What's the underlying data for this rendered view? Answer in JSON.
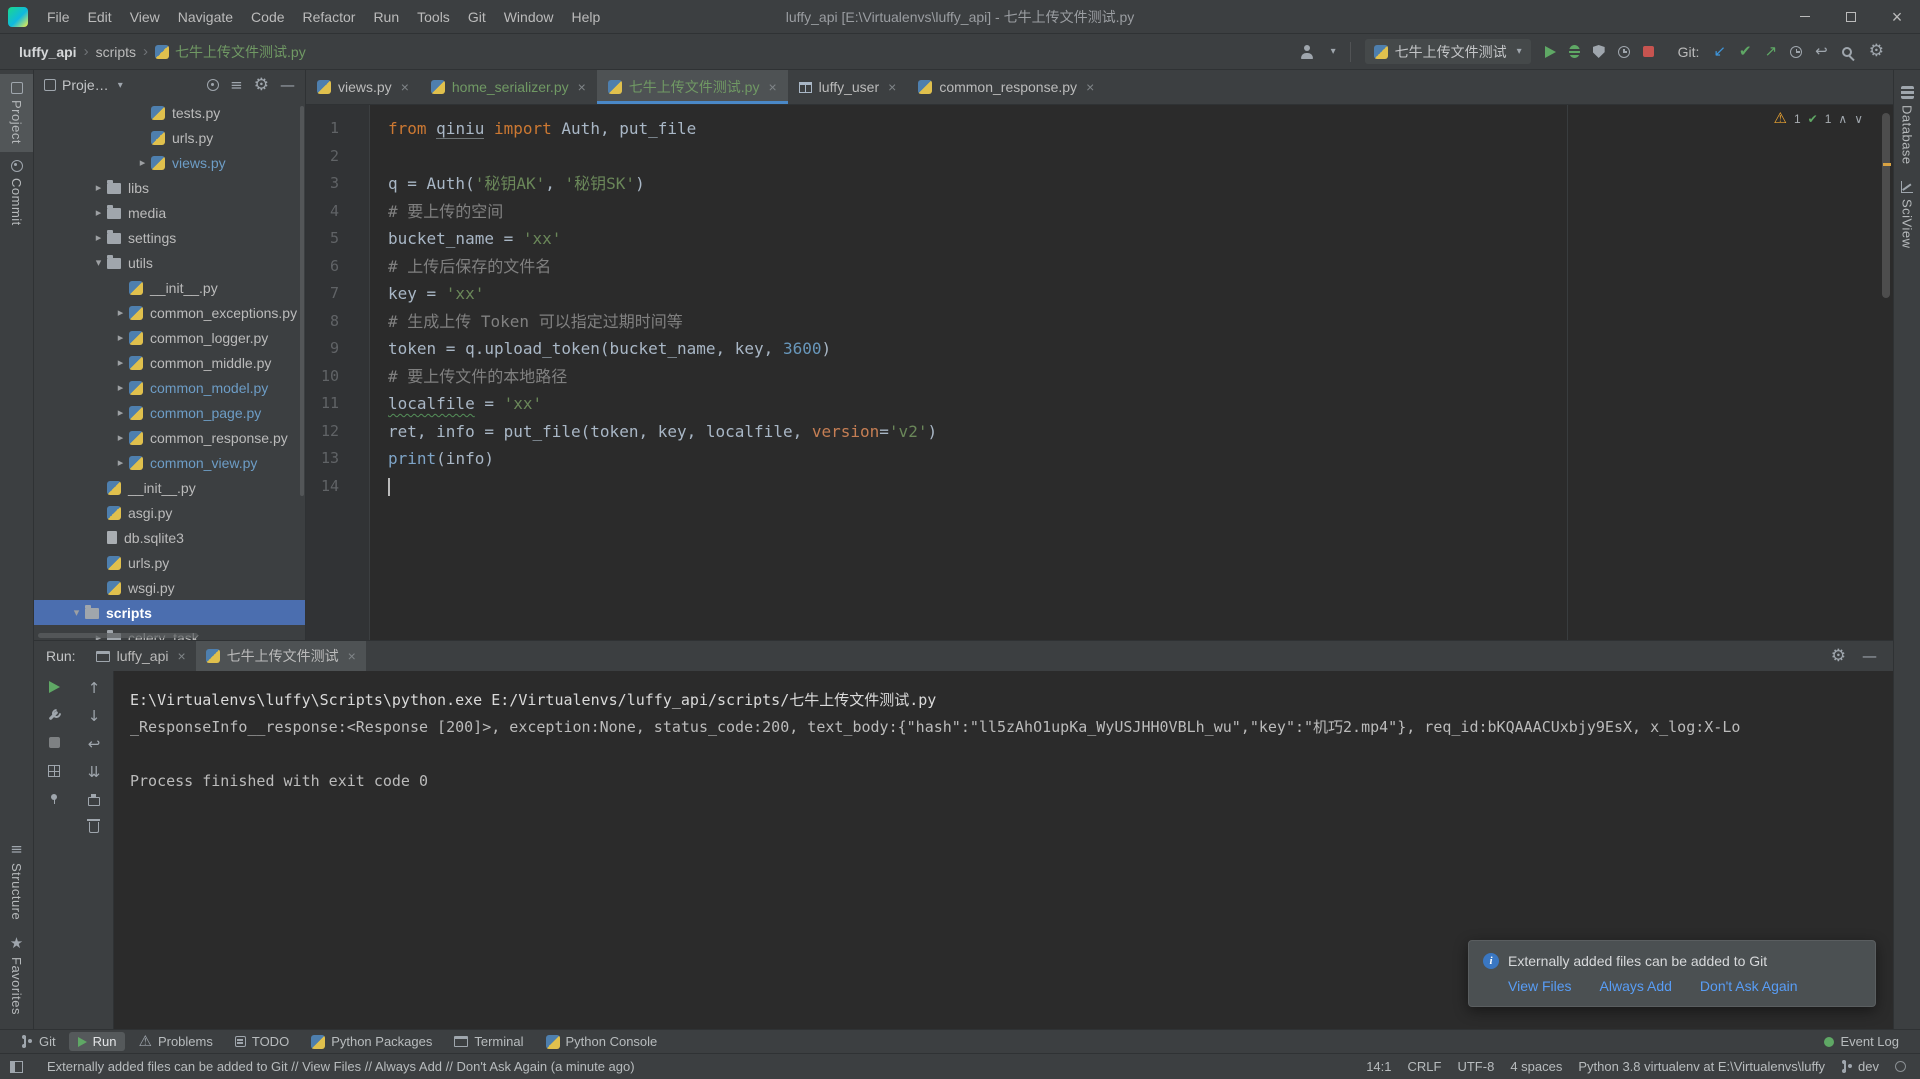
{
  "titlebar": {
    "title": "luffy_api [E:\\Virtualenvs\\luffy_api] - 七牛上传文件测试.py",
    "menus": [
      "File",
      "Edit",
      "View",
      "Navigate",
      "Code",
      "Refactor",
      "Run",
      "Tools",
      "Git",
      "Window",
      "Help"
    ]
  },
  "navbar": {
    "breadcrumbs": [
      "luffy_api",
      "scripts",
      "七牛上传文件测试.py"
    ],
    "run_config": "七牛上传文件测试",
    "git_label": "Git:",
    "action_icons": [
      "run-icon",
      "debug-icon",
      "coverage-icon",
      "profiler-icon",
      "stop-icon"
    ],
    "git_icons": [
      "git-update-icon",
      "git-commit-icon",
      "git-push-icon",
      "git-history-icon",
      "git-rollback-icon"
    ],
    "far_icons": [
      "search-icon",
      "settings-icon"
    ]
  },
  "left_stripe": {
    "top": [
      {
        "label": "Project",
        "icon": "project-icon",
        "active": true
      },
      {
        "label": "Commit",
        "icon": "commit-icon",
        "active": false
      }
    ],
    "bottom": [
      {
        "label": "Structure",
        "icon": "structure-icon",
        "active": false
      },
      {
        "label": "Favorites",
        "icon": "favorites-icon",
        "active": false
      }
    ]
  },
  "right_stripe": {
    "top": [
      {
        "label": "Database",
        "icon": "database-icon",
        "active": false
      },
      {
        "label": "SciView",
        "icon": "sciview-icon",
        "active": false
      }
    ]
  },
  "project_panel": {
    "title": "Proje…",
    "header_icons": [
      "locate-icon",
      "collapse-all-icon",
      "settings-icon",
      "hide-icon"
    ],
    "tree": [
      {
        "label": "tests.py",
        "depth": 4,
        "icon": "py",
        "chev": ""
      },
      {
        "label": "urls.py",
        "depth": 4,
        "icon": "py",
        "chev": ""
      },
      {
        "label": "views.py",
        "depth": 4,
        "icon": "py",
        "chev": ">",
        "color": "modified"
      },
      {
        "label": "libs",
        "depth": 2,
        "icon": "folder",
        "chev": ">"
      },
      {
        "label": "media",
        "depth": 2,
        "icon": "folder",
        "chev": ">"
      },
      {
        "label": "settings",
        "depth": 2,
        "icon": "folder",
        "chev": ">"
      },
      {
        "label": "utils",
        "depth": 2,
        "icon": "folder",
        "chev": "v"
      },
      {
        "label": "__init__.py",
        "depth": 3,
        "icon": "py",
        "chev": ""
      },
      {
        "label": "common_exceptions.py",
        "depth": 3,
        "icon": "py",
        "chev": ">"
      },
      {
        "label": "common_logger.py",
        "depth": 3,
        "icon": "py",
        "chev": ">"
      },
      {
        "label": "common_middle.py",
        "depth": 3,
        "icon": "py",
        "chev": ">"
      },
      {
        "label": "common_model.py",
        "depth": 3,
        "icon": "py",
        "chev": ">",
        "color": "modified"
      },
      {
        "label": "common_page.py",
        "depth": 3,
        "icon": "py",
        "chev": ">",
        "color": "modified"
      },
      {
        "label": "common_response.py",
        "depth": 3,
        "icon": "py",
        "chev": ">"
      },
      {
        "label": "common_view.py",
        "depth": 3,
        "icon": "py",
        "chev": ">",
        "color": "modified"
      },
      {
        "label": "__init__.py",
        "depth": 2,
        "icon": "py",
        "chev": ""
      },
      {
        "label": "asgi.py",
        "depth": 2,
        "icon": "py",
        "chev": ""
      },
      {
        "label": "db.sqlite3",
        "depth": 2,
        "icon": "file",
        "chev": ""
      },
      {
        "label": "urls.py",
        "depth": 2,
        "icon": "py",
        "chev": ""
      },
      {
        "label": "wsgi.py",
        "depth": 2,
        "icon": "py",
        "chev": ""
      },
      {
        "label": "scripts",
        "depth": 1,
        "icon": "folder",
        "chev": "v",
        "selected": true
      },
      {
        "label": "celery_task",
        "depth": 2,
        "icon": "folder",
        "chev": ">"
      }
    ]
  },
  "editor": {
    "tabs": [
      {
        "label": "views.py",
        "icon": "py",
        "active": false,
        "color": "default"
      },
      {
        "label": "home_serializer.py",
        "icon": "py",
        "active": false,
        "color": "new"
      },
      {
        "label": "七牛上传文件测试.py",
        "icon": "py",
        "active": true,
        "color": "new"
      },
      {
        "label": "luffy_user",
        "icon": "table",
        "active": false,
        "color": "default"
      },
      {
        "label": "common_response.py",
        "icon": "py",
        "active": false,
        "color": "default"
      }
    ],
    "inspections": {
      "warnings": "1",
      "typos": "1"
    },
    "code": [
      [
        [
          "from",
          "kw"
        ],
        [
          " ",
          ""
        ],
        [
          "qiniu",
          "lnk"
        ],
        [
          " ",
          ""
        ],
        [
          "import",
          "kw"
        ],
        [
          " Auth, put_file",
          ""
        ]
      ],
      [],
      [
        [
          "q = Auth(",
          ""
        ],
        [
          "'秘钥AK'",
          "str"
        ],
        [
          ", ",
          ""
        ],
        [
          "'秘钥SK'",
          "str"
        ],
        [
          ")",
          ""
        ]
      ],
      [
        [
          "# 要上传的空间",
          "cmt"
        ]
      ],
      [
        [
          "bucket_name = ",
          ""
        ],
        [
          "'xx'",
          "str"
        ]
      ],
      [
        [
          "# 上传后保存的文件名",
          "cmt"
        ]
      ],
      [
        [
          "key = ",
          ""
        ],
        [
          "'xx'",
          "str"
        ]
      ],
      [
        [
          "# 生成上传 Token 可以指定过期时间等",
          "cmt"
        ]
      ],
      [
        [
          "token = q.upload_token(bucket_name, key, ",
          ""
        ],
        [
          "3600",
          "num"
        ],
        [
          ")",
          ""
        ]
      ],
      [
        [
          "# 要上传文件的本地路径",
          "cmt"
        ]
      ],
      [
        [
          "localfile",
          "typo"
        ],
        [
          " = ",
          ""
        ],
        [
          "'xx'",
          "str"
        ]
      ],
      [
        [
          "ret, info = put_file(token, key, localfile, ",
          ""
        ],
        [
          "version",
          "param"
        ],
        [
          "=",
          ""
        ],
        [
          "'v2'",
          "str"
        ],
        [
          ")",
          ""
        ]
      ],
      [
        [
          "print",
          "builtin"
        ],
        [
          "(info)",
          ""
        ]
      ],
      []
    ]
  },
  "run_panel": {
    "label": "Run:",
    "tabs": [
      {
        "label": "luffy_api",
        "icon": "console-icon",
        "active": false
      },
      {
        "label": "七牛上传文件测试",
        "icon": "python-icon",
        "active": true
      }
    ],
    "header_icons": [
      "settings-icon",
      "hide-icon"
    ],
    "toolbar_icons": [
      "rerun-icon",
      "up-icon",
      "wrench-icon",
      "down-icon",
      "stop-icon-gray",
      "softwrap-icon",
      "restore-layout-icon",
      "scroll-end-icon",
      "pin-icon",
      "print-icon",
      "",
      "trash-icon"
    ],
    "console": [
      {
        "text": "E:\\Virtualenvs\\luffy\\Scripts\\python.exe E:/Virtualenvs/luffy_api/scripts/七牛上传文件测试.py",
        "bright": true
      },
      {
        "text": "_ResponseInfo__response:<Response [200]>, exception:None, status_code:200, text_body:{\"hash\":\"ll5zAhO1upKa_WyUSJHH0VBLh_wu\",\"key\":\"机巧2.mp4\"}, req_id:bKQAAACUxbjy9EsX, x_log:X-Lo",
        "bright": false
      },
      {
        "text": "",
        "bright": false
      },
      {
        "text": "Process finished with exit code 0",
        "bright": false
      }
    ]
  },
  "notification": {
    "message": "Externally added files can be added to Git",
    "actions": [
      "View Files",
      "Always Add",
      "Don't Ask Again"
    ]
  },
  "toolbar_bottom": {
    "left": [
      {
        "label": "Git",
        "icon": "branch-icon",
        "active": false
      },
      {
        "label": "Run",
        "icon": "run-small-icon",
        "active": true
      },
      {
        "label": "Problems",
        "icon": "problems-icon",
        "active": false
      },
      {
        "label": "TODO",
        "icon": "todo-icon",
        "active": false
      },
      {
        "label": "Python Packages",
        "icon": "python-icon",
        "active": false
      },
      {
        "label": "Terminal",
        "icon": "terminal-icon",
        "active": false
      },
      {
        "label": "Python Console",
        "icon": "python-icon",
        "active": false
      }
    ],
    "right": [
      {
        "label": "Event Log",
        "icon": "event-log-icon",
        "active": false
      }
    ]
  },
  "statusbar": {
    "message": "Externally added files can be added to Git // View Files // Always Add // Don't Ask Again (a minute ago)",
    "caret": "14:1",
    "line_sep": "CRLF",
    "encoding": "UTF-8",
    "indent": "4 spaces",
    "interpreter": "Python 3.8 virtualenv at E:\\Virtualenvs\\luffy",
    "branch": "dev"
  },
  "colors": {
    "accent_blue": "#4a88c7",
    "selection_blue": "#4b6eaf",
    "run_green": "#5fa865",
    "warning_yellow": "#f0a732",
    "vcs_new_green": "#709964",
    "vcs_modified_blue": "#6d9dc6",
    "stop_red": "#c75450",
    "editor_bg": "#2b2b2b",
    "panel_bg": "#3c3f41"
  }
}
